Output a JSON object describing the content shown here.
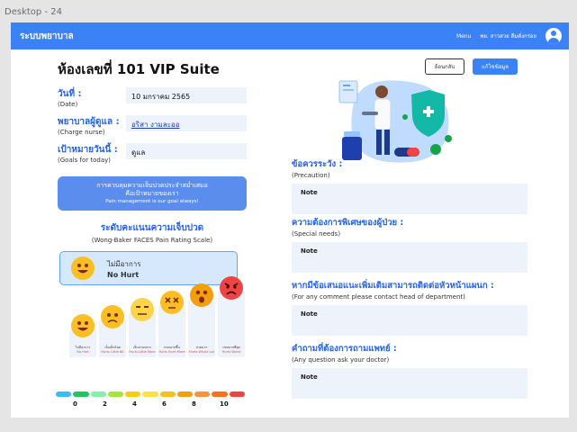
{
  "frame_label": "Desktop - 24",
  "navbar": {
    "brand": "ระบบพยาบาล",
    "menu": "Menu",
    "user": "พย. สาวสวย ลืมตั่งกร่อย"
  },
  "room_title": "ห้องเลขที่ 101 VIP Suite",
  "buttons": {
    "back": "ย้อนกลับ",
    "edit": "แก้ไขข้อมูล"
  },
  "info": [
    {
      "th": "วันที่ :",
      "en": "(Date)",
      "value": "10 มกราคม 2565"
    },
    {
      "th": "พยาบาลผู้ดูแล :",
      "en": "(Charge nurse)",
      "value": "อริสา งามละออ"
    },
    {
      "th": "เป้าหมายวันนี้ :",
      "en": "(Goals for today)",
      "value": "ดูแล"
    }
  ],
  "banner": {
    "line1": "การควบคุมความเจ็บปวดประจำสม่ำเสมอ",
    "line2": "คือเป้าหมายของเรา",
    "line3": "Pain management is our goal always!"
  },
  "scale": {
    "title": "ระดับคะแนนความเจ็บปวด",
    "subtitle": "(Wong-Baker FACES Pain Rating Scale)"
  },
  "selected": {
    "th": "ไม่มีอาการ",
    "en": "No Hurt"
  },
  "faces": [
    {
      "th": "ไม่มีอาการ",
      "en": "No Hurt",
      "color": "#fbbf24",
      "glyph": "☺"
    },
    {
      "th": "เจ็บเล็กน้อย",
      "en": "Hurts Little Bit",
      "color": "#fbbf24",
      "glyph": "•̀"
    },
    {
      "th": "เจ็บปานกลาง",
      "en": "Hurts Little More",
      "color": "#fcd34d",
      "glyph": "–"
    },
    {
      "th": "ปวดมากขึ้น",
      "en": "Hurts Even More",
      "color": "#fbbf24",
      "glyph": "×"
    },
    {
      "th": "ปวดมาก",
      "en": "Hurts Whole Lot",
      "color": "#f59e0b",
      "glyph": "◎"
    },
    {
      "th": "ปวดมากที่สุด",
      "en": "Hurts Worst",
      "color": "#ef4444",
      "glyph": "☹"
    }
  ],
  "bar_colors": [
    "#38bdf8",
    "#22c55e",
    "#86efac",
    "#a3e635",
    "#facc15",
    "#fde047",
    "#fbbf24",
    "#f59e0b",
    "#fb923c",
    "#f97316",
    "#ef4444"
  ],
  "scale_numbers": [
    "0",
    "2",
    "4",
    "6",
    "8",
    "10"
  ],
  "sections": [
    {
      "th": "ข้อควรระวัง :",
      "en": "(Precaution)",
      "note": "Note"
    },
    {
      "th": "ความต้องการพิเศษของผู้ป่วย :",
      "en": "(Special needs)",
      "note": "Note"
    },
    {
      "th": "หากมีข้อเสนอแนะเพิ่มเติมสามารถติดต่อหัวหน้าแผนก :",
      "en": "(For any comment please contact head of department)",
      "note": "Note"
    },
    {
      "th": "คำถามที่ต้องการถามแพทย์ :",
      "en": "(Any question ask your doctor)",
      "note": "Note"
    }
  ]
}
